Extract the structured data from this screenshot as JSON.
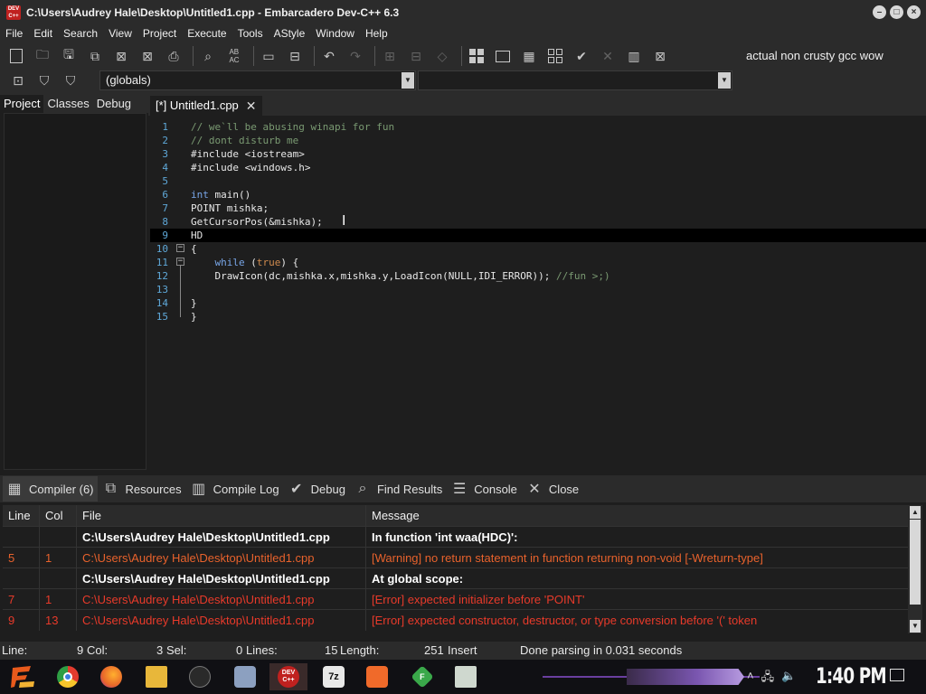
{
  "window": {
    "title": "C:\\Users\\Audrey Hale\\Desktop\\Untitled1.cpp - Embarcadero Dev-C++ 6.3",
    "icon_text": "DEV C++"
  },
  "menu": [
    "File",
    "Edit",
    "Search",
    "View",
    "Project",
    "Execute",
    "Tools",
    "AStyle",
    "Window",
    "Help"
  ],
  "toolbar": {
    "compiler": "actual non crusty gcc wow",
    "scope_combo": "(globals)",
    "members_combo": ""
  },
  "left_panel": {
    "tabs": [
      "Project",
      "Classes",
      "Debug"
    ],
    "active_tab": "Project"
  },
  "editor": {
    "tab_label": "[*] Untitled1.cpp",
    "lines": [
      {
        "n": "1",
        "text": "// we`ll be abusing winapi for fun",
        "kind": "comment"
      },
      {
        "n": "2",
        "text": "// dont disturb me",
        "kind": "comment"
      },
      {
        "n": "3",
        "text": "#include <iostream>",
        "kind": "plain"
      },
      {
        "n": "4",
        "text": "#include <windows.h>",
        "kind": "plain"
      },
      {
        "n": "5",
        "text": "",
        "kind": "plain"
      },
      {
        "n": "6",
        "text": "int main()",
        "kind": "kw_int"
      },
      {
        "n": "7",
        "text": "POINT mishka;",
        "kind": "plain"
      },
      {
        "n": "8",
        "text": "GetCursorPos(&mishka);",
        "kind": "plain"
      },
      {
        "n": "9",
        "text": "HD",
        "kind": "plain"
      },
      {
        "n": "10",
        "text": "{",
        "kind": "plain"
      },
      {
        "n": "11",
        "text": "    while (true) {",
        "kind": "while"
      },
      {
        "n": "12",
        "text": "    DrawIcon(dc,mishka.x,mishka.y,LoadIcon(NULL,IDI_ERROR)); ",
        "comment": "//fun >;)",
        "kind": "drawicon"
      },
      {
        "n": "13",
        "text": "",
        "kind": "plain"
      },
      {
        "n": "14",
        "text": "}",
        "kind": "plain"
      },
      {
        "n": "15",
        "text": "}",
        "kind": "plain"
      }
    ],
    "current_line": 9
  },
  "bottom_tabs": [
    "Compiler (6)",
    "Resources",
    "Compile Log",
    "Debug",
    "Find Results",
    "Console",
    "Close"
  ],
  "results": {
    "headers": [
      "Line",
      "Col",
      "File",
      "Message"
    ],
    "rows": [
      {
        "line": "",
        "col": "",
        "file": "C:\\Users\\Audrey Hale\\Desktop\\Untitled1.cpp",
        "message": "In function 'int waa(HDC)':",
        "type": "bold"
      },
      {
        "line": "5",
        "col": "1",
        "file": "C:\\Users\\Audrey Hale\\Desktop\\Untitled1.cpp",
        "message": "[Warning] no return statement in function returning non-void [-Wreturn-type]",
        "type": "warn"
      },
      {
        "line": "",
        "col": "",
        "file": "C:\\Users\\Audrey Hale\\Desktop\\Untitled1.cpp",
        "message": "At global scope:",
        "type": "bold"
      },
      {
        "line": "7",
        "col": "1",
        "file": "C:\\Users\\Audrey Hale\\Desktop\\Untitled1.cpp",
        "message": "[Error] expected initializer before 'POINT'",
        "type": "err"
      },
      {
        "line": "9",
        "col": "13",
        "file": "C:\\Users\\Audrey Hale\\Desktop\\Untitled1.cpp",
        "message": "[Error] expected constructor, destructor, or type conversion before '(' token",
        "type": "err"
      }
    ]
  },
  "status": {
    "line_label": "Line:",
    "line_value": "9",
    "col_label": "Col:",
    "col_value": "3",
    "sel_label": "Sel:",
    "sel_value": "0",
    "lines_label": "Lines:",
    "lines_value": "15",
    "length_label": "Length:",
    "length_value": "251",
    "mode": "Insert",
    "message": "Done parsing in 0.031 seconds"
  },
  "taskbar": {
    "clock": "1:40 PM",
    "apps": [
      {
        "name": "chrome-icon",
        "color": "#2e9e44"
      },
      {
        "name": "firefox-icon",
        "color": "#e8662a"
      },
      {
        "name": "file-explorer-icon",
        "color": "#e8b73a"
      },
      {
        "name": "steam-icon",
        "color": "#3a3a3a"
      },
      {
        "name": "network-tool-icon",
        "color": "#8ca0c0"
      },
      {
        "name": "devcpp-icon",
        "color": "#c0211f",
        "label": "DEV C++"
      },
      {
        "name": "7zip-icon",
        "color": "#e8e8e8",
        "label": "7z"
      },
      {
        "name": "xampp-icon",
        "color": "#f06a2a"
      },
      {
        "name": "app-green-icon",
        "color": "#3aa84a",
        "label": "F"
      },
      {
        "name": "terminal-icon",
        "color": "#cfd8cf"
      }
    ]
  },
  "colors": {
    "bg": "#1e1e1e",
    "chrome": "#2b2b2b",
    "warning": "#e8622c",
    "error": "#e83a2a",
    "line_number": "#5fa8d8"
  }
}
